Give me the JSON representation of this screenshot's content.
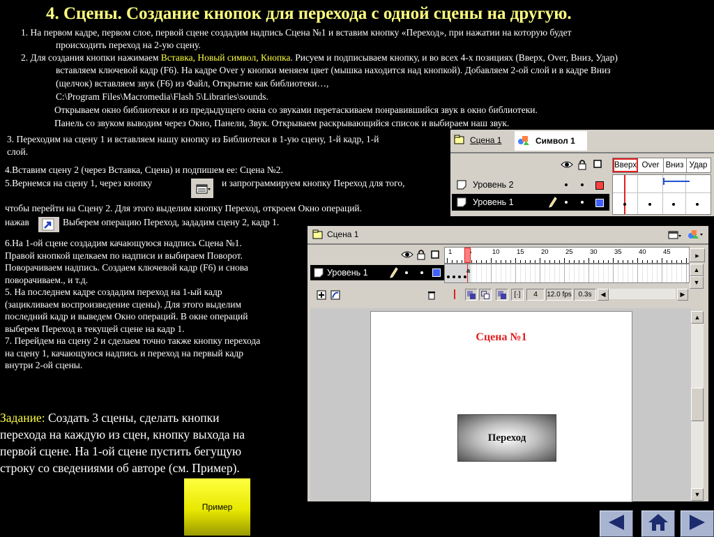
{
  "title": "4. Сцены. Создание кнопок для перехода с одной сцены на другую.",
  "intro": {
    "p1_line1": "1. На первом кадре, первом слое, первой сцене создадим надпись Сцена №1 и  вставим кнопку «Переход», при нажатии на которую будет",
    "p1_line2": "происходить переход на 2-ую сцену.",
    "p2_line1_pre": "2. Для создания кнопки нажимаем ",
    "p2_line1_hl": "Вставка, Новый символ, Кнопка",
    "p2_line1_post": ". Рисуем и подписываем кнопку, и во всех 4-х позициях (Вверх, Over, Вниз, Удар)",
    "p2_line2": "вставляем  ключевой кадр (F6). На кадре Over у кнопки меняем цвет (мышка находится над кнопкой). Добавляем 2-ой слой и в кадре Вниз",
    "p2_line3": "(щелчок) вставляем звук (F6) из Файл, Открытие как библиотеки…,",
    "p2_line4": "C:\\Program Files\\Macromedia\\Flash 5\\Libraries\\sounds.",
    "p2_line5": "Открываем окно библиотеки и из предыдущего окна со звуками перетаскиваем понравившийся звук в окно библиотеки.",
    "p2_line6": "Панель со звуком выводим через Окно, Панели, Звук. Открываем раскрывающийся список и выбираем наш звук."
  },
  "step3": {
    "line1": "3. Переходим на сцену 1 и вставляем нашу кнопку из Библиотеки в 1-ую сцену, 1-й кадр, 1-й",
    "line2": "слой."
  },
  "step4": {
    "line1": "4.Вставим сцену 2 (через Вставка, Сцена) и подпишем ее: Сцена №2."
  },
  "step5": {
    "line1a": "5.Вернемся на сцену 1, через кнопку",
    "line1b": "и запрограммируем кнопку Переход для того,",
    "line2": "чтобы перейти на Сцену 2. Для этого выделим кнопку Переход, откроем Окно операций.",
    "line3a": "нажав",
    "line3b": "Выберем операцию Переход, зададим сцену 2, кадр 1."
  },
  "left_steps": [
    "6.На 1-ой сцене создадим качающуюся надпись Сцена №1.",
    "Правой кнопкой щелкаем по надписи и выбираем Поворот.",
    "Поворачиваем надпись. Создаем ключевой кадр (F6) и снова",
    "поворачиваем., и т.д.",
    "5. На последнем кадре создадим переход на 1-ый кадр",
    "(зацикливаем воспроизведение сцены). Для этого выделим",
    "последний кадр и выведем Окно операций. В окне операций",
    "выберем Переход в текущей сцене на кадр 1.",
    "7. Перейдем на сцену 2 и сделаем точно также кнопку перехода",
    "на сцену 1,  качающуюся надпись  и переход на первый кадр",
    "внутри 2-ой сцены."
  ],
  "task": {
    "label": "Задание:",
    "line1": " Создать 3 сцены, сделать кнопки",
    "line2": "перехода на каждую из сцен, кнопку выхода на",
    "line3": "первой сцене. На 1-ой сцене пустить бегущую",
    "line4": "строку со сведениями об авторе (см. Пример)."
  },
  "example_button": "Пример",
  "symbol_panel": {
    "tab_scene": "Сцена 1",
    "tab_symbol": "Символ 1",
    "frames": [
      "Вверх",
      "Over",
      "Вниз",
      "Удар"
    ],
    "layers": [
      "Уровень 2",
      "Уровень 1"
    ],
    "layer2_color": "#ff4040",
    "layer1_color": "#4060ff"
  },
  "timeline_panel": {
    "scene_label": "Сцена 1",
    "layer": "Уровень 1",
    "layer_color": "#4060ff",
    "ruler": [
      "1",
      "5",
      "10",
      "15",
      "20",
      "25",
      "30",
      "35",
      "40",
      "45"
    ],
    "current_frame": "4",
    "fps": "12.0 fps",
    "time": "0.3s"
  },
  "stage": {
    "scene_text": "Сцена №1",
    "scene_text_color": "#e02020",
    "button_text": "Переход"
  },
  "nav": {
    "prev": "prev-icon",
    "home": "home-icon",
    "next": "next-icon"
  }
}
